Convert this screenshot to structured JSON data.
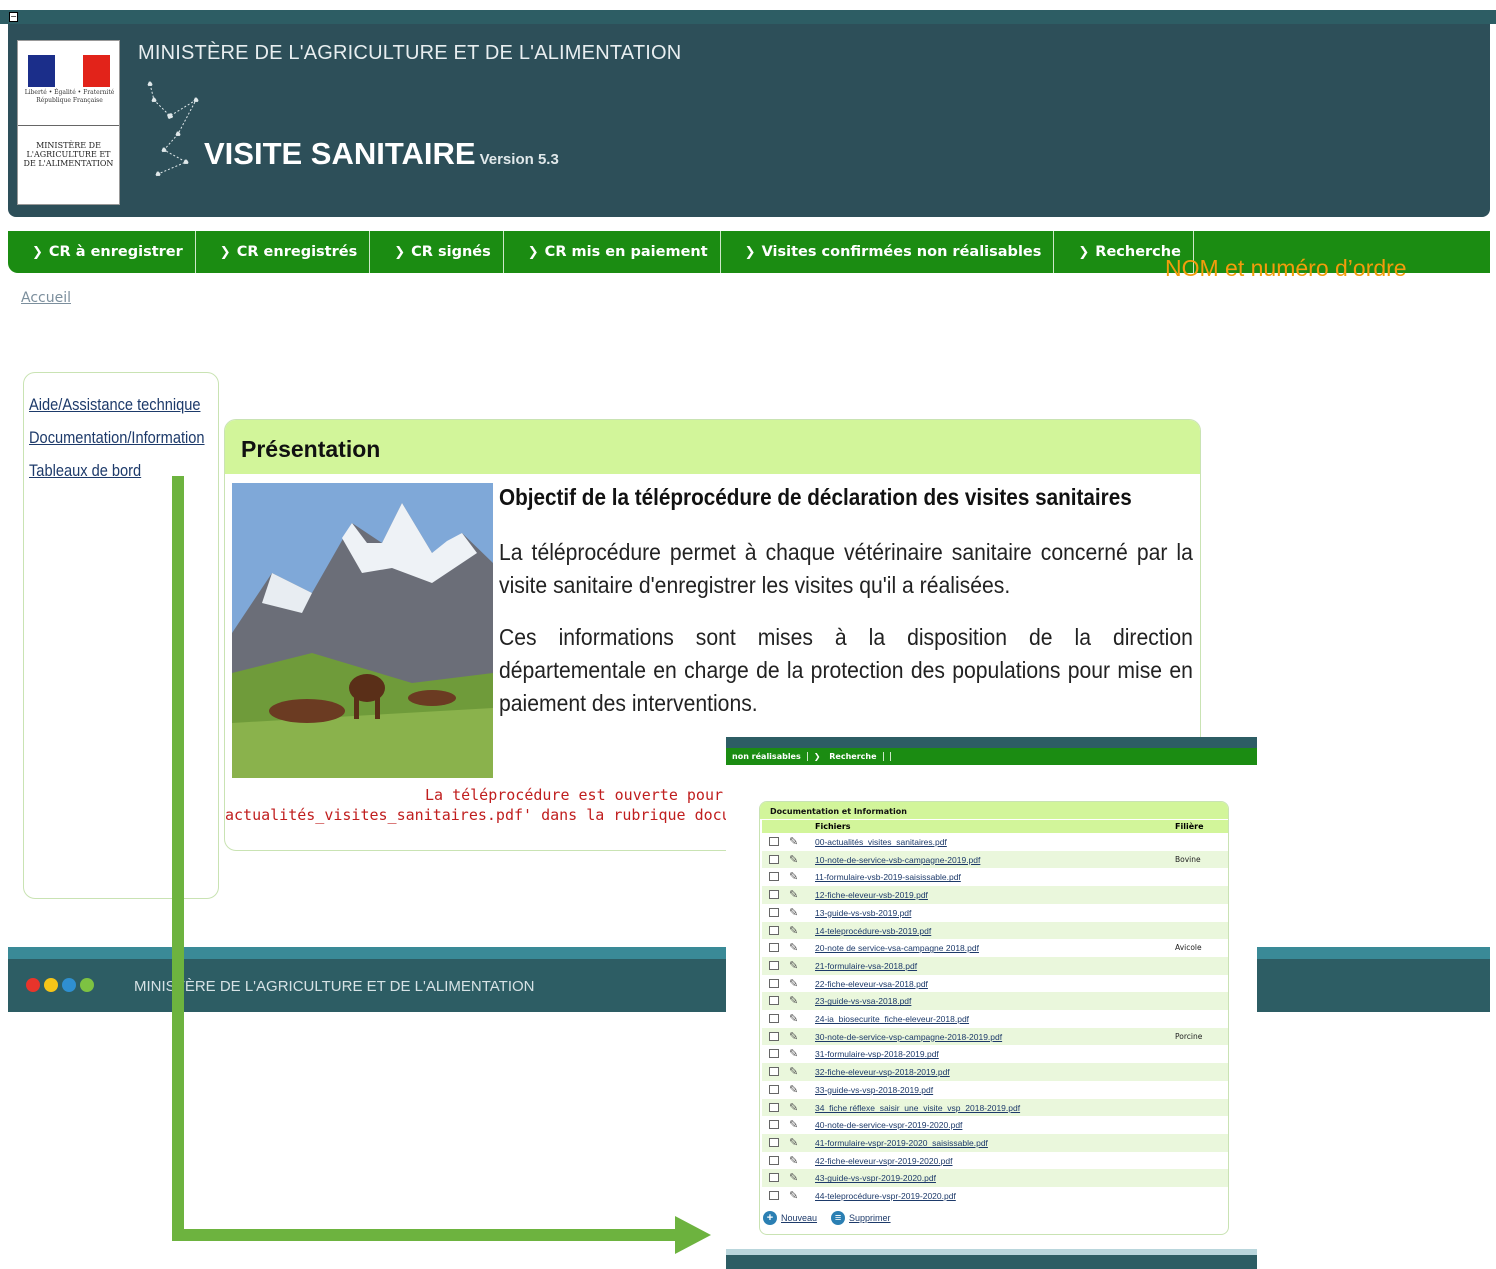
{
  "header": {
    "ministry_title": "MINISTÈRE DE L'AGRICULTURE ET DE L'ALIMENTATION",
    "app_title": "VISITE SANITAIRE",
    "app_version": "Version 5.3",
    "logo_motto": "Liberté • Égalité • Fraternité",
    "logo_country": "République Française",
    "logo_ministry": "MINISTÈRE DE L'AGRICULTURE ET DE L'ALIMENTATION",
    "colors": {
      "header": "#2d4f59",
      "nav": "#1b8c12",
      "accent": "#f39c0c",
      "panel_head": "#d2f59a"
    }
  },
  "nav": {
    "items": [
      {
        "label": "CR à enregistrer"
      },
      {
        "label": "CR enregistrés"
      },
      {
        "label": "CR signés"
      },
      {
        "label": "CR mis en paiement"
      },
      {
        "label": "Visites confirmées non réalisables"
      },
      {
        "label": "Recherche"
      }
    ],
    "user_label": "NOM et numéro d’ordre"
  },
  "breadcrumb": {
    "home": "Accueil"
  },
  "sidebar": {
    "items": [
      {
        "label": "Aide/Assistance technique"
      },
      {
        "label": "Documentation/Information"
      },
      {
        "label": "Tableaux de bord"
      }
    ]
  },
  "presentation": {
    "title": "Présentation",
    "heading": "Objectif de la téléprocédure de déclaration des visites sanitaires",
    "para1": "La téléprocédure permet à chaque vétérinaire sanitaire concerné par la visite sanitaire d'enregistrer les visites qu'il a réalisées.",
    "para2": "Ces informations sont mises à la disposition de la direction départementale en charge de la protection des populations pour mise en paiement des interventions.",
    "notice_line1": "La téléprocédure est ouverte pour la saisi",
    "notice_line2": "actualités_visites_sanitaires.pdf' dans la rubrique documentation/info"
  },
  "footer": {
    "text": "MINISTÈRE DE L'AGRICULTURE ET DE L'ALIMENTATION",
    "dot_colors": [
      "#e8342b",
      "#f5c518",
      "#2f8fd0",
      "#7dc242"
    ]
  },
  "inset": {
    "nav": [
      "non réalisables",
      "Recherche"
    ],
    "title": "Documentation et Information",
    "col_files": "Fichiers",
    "col_filiere": "Filière",
    "rows": [
      {
        "file": "00-actualités_visites_sanitaires.pdf",
        "filiere": ""
      },
      {
        "file": "10-note-de-service-vsb-campagne-2019.pdf",
        "filiere": "Bovine"
      },
      {
        "file": "11-formulaire-vsb-2019-saisissable.pdf",
        "filiere": ""
      },
      {
        "file": "12-fiche-eleveur-vsb-2019.pdf",
        "filiere": ""
      },
      {
        "file": "13-guide-vs-vsb-2019.pdf",
        "filiere": ""
      },
      {
        "file": "14-teleprocédure-vsb-2019.pdf",
        "filiere": ""
      },
      {
        "file": "20-note de service-vsa-campagne 2018.pdf",
        "filiere": "Avicole"
      },
      {
        "file": "21-formulaire-vsa-2018.pdf",
        "filiere": ""
      },
      {
        "file": "22-fiche-eleveur-vsa-2018.pdf",
        "filiere": ""
      },
      {
        "file": "23-guide-vs-vsa-2018.pdf",
        "filiere": ""
      },
      {
        "file": "24-ia_biosecurite_fiche-eleveur-2018.pdf",
        "filiere": ""
      },
      {
        "file": "30-note-de-service-vsp-campagne-2018-2019.pdf",
        "filiere": "Porcine"
      },
      {
        "file": "31-formulaire-vsp-2018-2019.pdf",
        "filiere": ""
      },
      {
        "file": "32-fiche-eleveur-vsp-2018-2019.pdf",
        "filiere": ""
      },
      {
        "file": "33-guide-vs-vsp-2018-2019.pdf",
        "filiere": ""
      },
      {
        "file": "34_fiche réflexe_saisir_une_visite_vsp_2018-2019.pdf",
        "filiere": ""
      },
      {
        "file": "40-note-de-service-vspr-2019-2020.pdf",
        "filiere": ""
      },
      {
        "file": "41-formulaire-vspr-2019-2020_saisissable.pdf",
        "filiere": ""
      },
      {
        "file": "42-fiche-eleveur-vspr-2019-2020.pdf",
        "filiere": ""
      },
      {
        "file": "43-guide-vs-vspr-2019-2020.pdf",
        "filiere": ""
      },
      {
        "file": "44-teleprocédure-vspr-2019-2020.pdf",
        "filiere": ""
      }
    ],
    "new_label": "Nouveau",
    "delete_label": "Supprimer"
  }
}
